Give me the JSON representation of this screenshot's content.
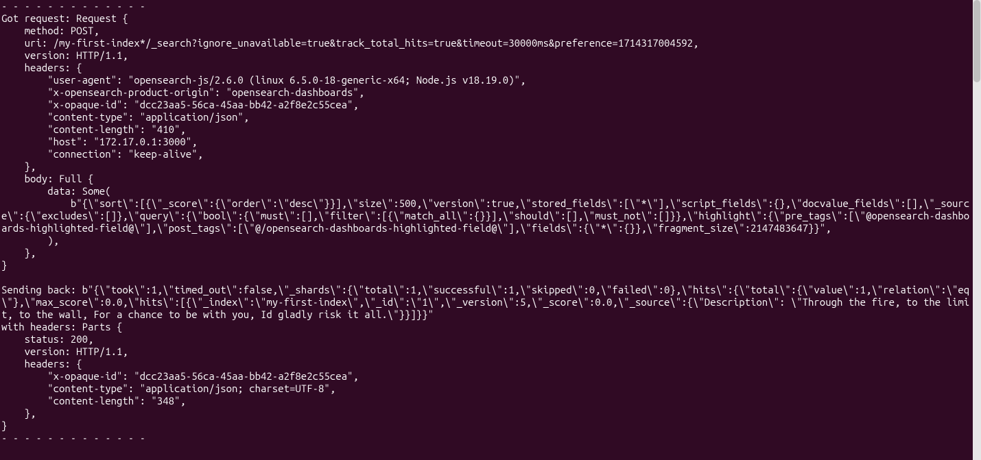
{
  "colors": {
    "terminal_bg": "#300a24",
    "terminal_fg": "#ffffff",
    "scrollbar_track": "#e6e6e6",
    "scrollbar_thumb": "#bfbfbf"
  },
  "terminal": {
    "lines": [
      "- - - - - - - - - - - - -",
      "Got request: Request {",
      "    method: POST,",
      "    uri: /my-first-index*/_search?ignore_unavailable=true&track_total_hits=true&timeout=30000ms&preference=1714317004592,",
      "    version: HTTP/1.1,",
      "    headers: {",
      "        \"user-agent\": \"opensearch-js/2.6.0 (linux 6.5.0-18-generic-x64; Node.js v18.19.0)\",",
      "        \"x-opensearch-product-origin\": \"opensearch-dashboards\",",
      "        \"x-opaque-id\": \"dcc23aa5-56ca-45aa-bb42-a2f8e2c55cea\",",
      "        \"content-type\": \"application/json\",",
      "        \"content-length\": \"410\",",
      "        \"host\": \"172.17.0.1:3000\",",
      "        \"connection\": \"keep-alive\",",
      "    },",
      "    body: Full {",
      "        data: Some(",
      "            b\"{\\\"sort\\\":[{\\\"_score\\\":{\\\"order\\\":\\\"desc\\\"}}],\\\"size\\\":500,\\\"version\\\":true,\\\"stored_fields\\\":[\\\"*\\\"],\\\"script_fields\\\":{},\\\"docvalue_fields\\\":[],\\\"_source\\\":{\\\"excludes\\\":[]},\\\"query\\\":{\\\"bool\\\":{\\\"must\\\":[],\\\"filter\\\":[{\\\"match_all\\\":{}}],\\\"should\\\":[],\\\"must_not\\\":[]}},\\\"highlight\\\":{\\\"pre_tags\\\":[\\\"@opensearch-dashboards-highlighted-field@\\\"],\\\"post_tags\\\":[\\\"@/opensearch-dashboards-highlighted-field@\\\"],\\\"fields\\\":{\\\"*\\\":{}},\\\"fragment_size\\\":2147483647}}\",",
      "        ),",
      "    },",
      "}",
      "",
      "Sending back: b\"{\\\"took\\\":1,\\\"timed_out\\\":false,\\\"_shards\\\":{\\\"total\\\":1,\\\"successful\\\":1,\\\"skipped\\\":0,\\\"failed\\\":0},\\\"hits\\\":{\\\"total\\\":{\\\"value\\\":1,\\\"relation\\\":\\\"eq\\\"},\\\"max_score\\\":0.0,\\\"hits\\\":[{\\\"_index\\\":\\\"my-first-index\\\",\\\"_id\\\":\\\"1\\\",\\\"_version\\\":5,\\\"_score\\\":0.0,\\\"_source\\\":{\\\"Description\\\": \\\"Through the fire, to the limit, to the wall, For a chance to be with you, Id gladly risk it all.\\\"}}]}}\"",
      "with headers: Parts {",
      "    status: 200,",
      "    version: HTTP/1.1,",
      "    headers: {",
      "        \"x-opaque-id\": \"dcc23aa5-56ca-45aa-bb42-a2f8e2c55cea\",",
      "        \"content-type\": \"application/json; charset=UTF-8\",",
      "        \"content-length\": \"348\",",
      "    },",
      "}",
      "- - - - - - - - - - - - -"
    ]
  }
}
